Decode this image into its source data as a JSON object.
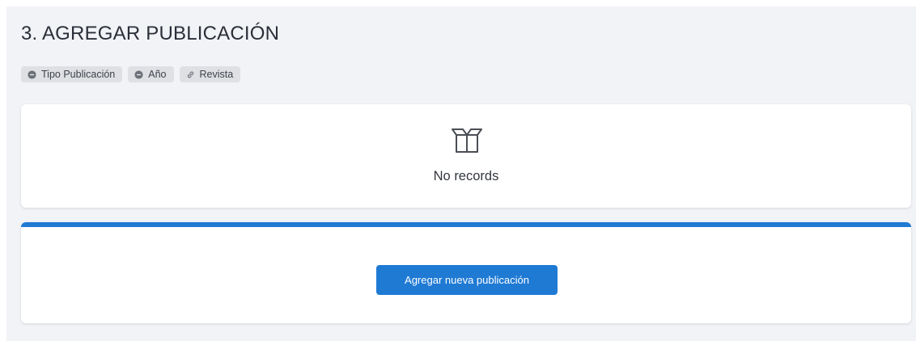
{
  "section": {
    "title": "3. AGREGAR PUBLICACIÓN"
  },
  "tags": [
    {
      "label": "Tipo Publicación",
      "icon": "circle-minus-icon"
    },
    {
      "label": "Año",
      "icon": "circle-minus-icon"
    },
    {
      "label": "Revista",
      "icon": "link-icon"
    }
  ],
  "records": {
    "empty_icon": "empty-box-icon",
    "empty_text": "No records"
  },
  "actions": {
    "add_label": "Agregar nueva publicación"
  },
  "colors": {
    "accent": "#1f7ad4",
    "panel_background": "#f2f3f7",
    "tag_background": "#dfe0e4"
  }
}
